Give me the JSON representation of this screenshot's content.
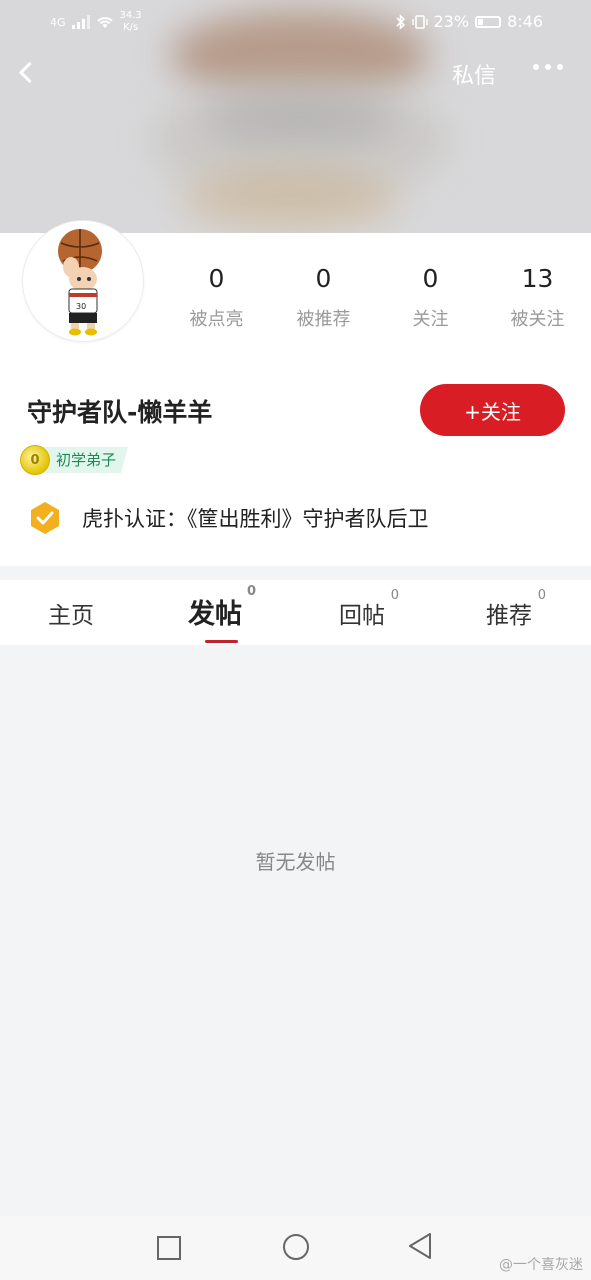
{
  "statusbar": {
    "signal": "4G",
    "speed": "34.3",
    "speed_unit": "K/s",
    "battery": "23%",
    "time": "8:46"
  },
  "header": {
    "back_icon": "chevron-left-icon",
    "message_label": "私信",
    "more_icon": "more-dots-icon"
  },
  "profile": {
    "stats": [
      {
        "value": "0",
        "label": "被点亮"
      },
      {
        "value": "0",
        "label": "被推荐"
      },
      {
        "value": "0",
        "label": "关注"
      },
      {
        "value": "13",
        "label": "被关注"
      }
    ],
    "username": "守护者队-懒羊羊",
    "follow_label": "+关注",
    "level_number": "0",
    "level_label": "初学弟子",
    "verify_text": "虎扑认证：《筐出胜利》守护者队后卫"
  },
  "tabs": [
    {
      "label": "主页",
      "count": ""
    },
    {
      "label": "发帖",
      "count": "0"
    },
    {
      "label": "回帖",
      "count": "0"
    },
    {
      "label": "推荐",
      "count": "0"
    }
  ],
  "active_tab": "发帖",
  "empty_state": "暂无发帖",
  "watermark": "@一个喜灰迷",
  "colors": {
    "accent": "#d81e24",
    "level_bg": "#e3f6ee",
    "level_text": "#1a8a52",
    "verify": "#f2b01e"
  }
}
